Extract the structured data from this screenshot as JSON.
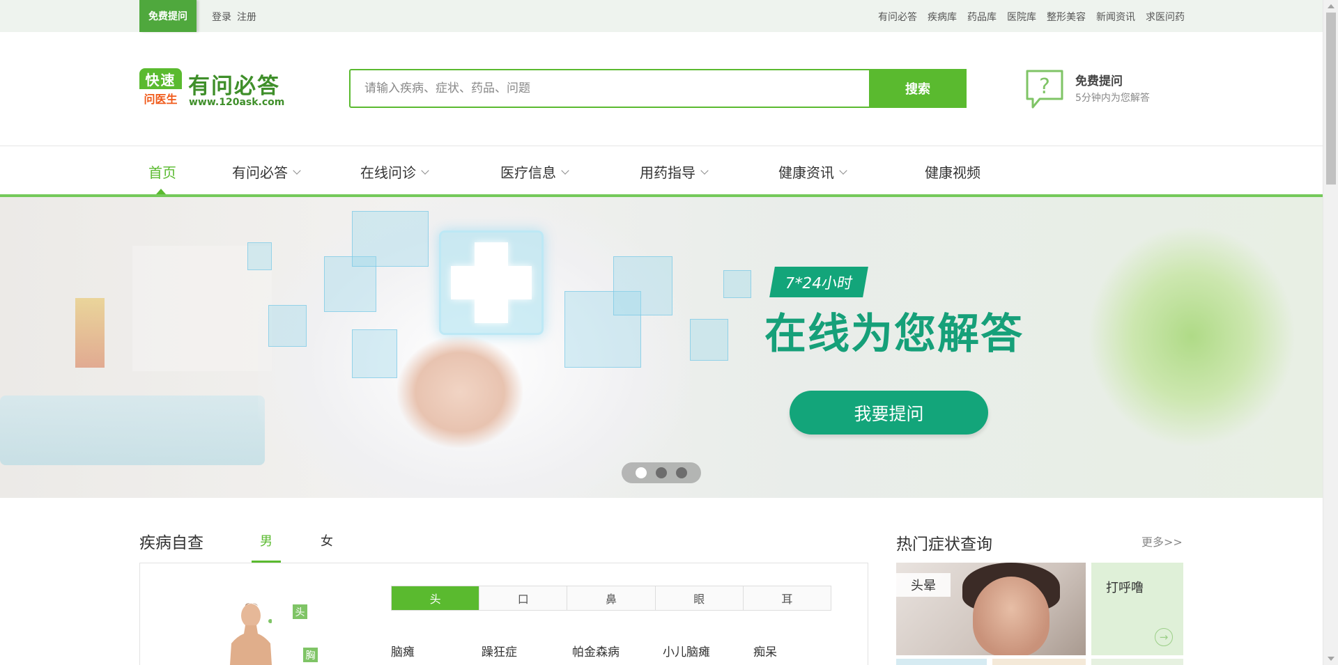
{
  "topbar": {
    "free_ask": "免费提问",
    "login": "登录",
    "register": "注册",
    "links": [
      "有问必答",
      "疾病库",
      "药品库",
      "医院库",
      "整形美容",
      "新闻资讯",
      "求医问药"
    ]
  },
  "header": {
    "logo_badge_top": "快速",
    "logo_badge_bottom": "问医生",
    "logo_name": "有问必答",
    "logo_url": "www.120ask.com",
    "search_placeholder": "请输入疾病、症状、药品、问题",
    "search_button": "搜索",
    "help_title": "免费提问",
    "help_subtitle": "5分钟内为您解答"
  },
  "nav": {
    "items": [
      {
        "label": "首页",
        "active": true
      },
      {
        "label": "有问必答"
      },
      {
        "label": "在线问诊"
      },
      {
        "label": "医疗信息"
      },
      {
        "label": "用药指导"
      },
      {
        "label": "健康资讯"
      },
      {
        "label": "健康视频"
      }
    ]
  },
  "banner": {
    "tag": "7*24小时",
    "headline": "在线为您解答",
    "cta": "我要提问",
    "slide_count": 3,
    "active_slide": 1
  },
  "self_check": {
    "title": "疾病自查",
    "tabs": [
      "男",
      "女"
    ],
    "active_tab": "男",
    "body_labels": [
      "头",
      "胸"
    ],
    "parts": [
      "头",
      "口",
      "鼻",
      "眼",
      "耳"
    ],
    "active_part": "头",
    "diseases": [
      "脑瘫",
      "躁狂症",
      "帕金森病",
      "小儿脑瘫",
      "痴呆"
    ]
  },
  "hot_symptoms": {
    "title": "热门症状查询",
    "more": "更多>>",
    "cards": [
      "头晕",
      "打呼噜"
    ]
  },
  "colors": {
    "brand_green": "#5aba2f",
    "banner_teal": "#13a57a",
    "logo_orange": "#f05a1a"
  }
}
